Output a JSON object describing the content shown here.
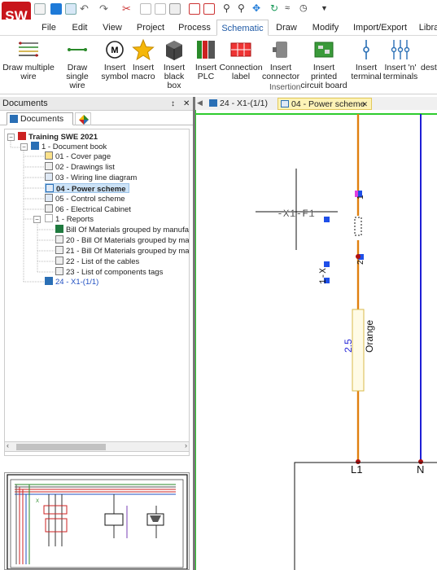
{
  "app": {
    "logo_text": "SW"
  },
  "menu": {
    "tabs": [
      "File",
      "Edit",
      "View",
      "Project",
      "Process",
      "Schematic",
      "Draw",
      "Modify",
      "Import/Export",
      "Libra"
    ],
    "active": "Schematic"
  },
  "ribbon": {
    "buttons": [
      {
        "line1": "Draw multiple",
        "line2": "wire",
        "icon": "multi-wire-icon"
      },
      {
        "line1": "Draw single",
        "line2": "wire",
        "icon": "single-wire-icon"
      },
      {
        "line1": "Insert",
        "line2": "symbol",
        "icon": "motor-symbol-icon"
      },
      {
        "line1": "Insert",
        "line2": "macro",
        "icon": "star-macro-icon"
      },
      {
        "line1": "Insert",
        "line2": "black box",
        "icon": "black-box-icon"
      },
      {
        "line1": "Insert",
        "line2": "PLC",
        "icon": "plc-icon"
      },
      {
        "line1": "Connection",
        "line2": "label",
        "icon": "connection-label-icon"
      },
      {
        "line1": "Insert",
        "line2": "connector",
        "icon": "connector-icon"
      },
      {
        "line1": "Insert printed",
        "line2": "circuit board",
        "icon": "pcb-icon"
      },
      {
        "line1": "Insert",
        "line2": "terminal",
        "icon": "terminal-icon"
      },
      {
        "line1": "Insert 'n'",
        "line2": "terminals",
        "icon": "n-terminals-icon"
      },
      {
        "line1": "desti",
        "line2": "",
        "icon": ""
      }
    ],
    "group_label": "Insertion"
  },
  "documents_panel": {
    "title": "Documents",
    "pin": "↕",
    "close": "✕",
    "tabs": [
      "Documents",
      ""
    ],
    "tree": [
      {
        "label": "Training SWE 2021",
        "level": 0,
        "bold": true,
        "icon": "project-icon"
      },
      {
        "label": "1 - Document book",
        "level": 1,
        "icon": "book-icon"
      },
      {
        "label": "01 - Cover page",
        "level": 2,
        "icon": "cover-page-icon"
      },
      {
        "label": "02 - Drawings list",
        "level": 2,
        "icon": "drawings-list-icon"
      },
      {
        "label": "03 - Wiring line diagram",
        "level": 2,
        "icon": "wiring-diagram-icon"
      },
      {
        "label": "04 - Power scheme",
        "level": 2,
        "bold": true,
        "selected": true,
        "icon": "power-scheme-icon"
      },
      {
        "label": "05 - Control scheme",
        "level": 2,
        "icon": "control-scheme-icon"
      },
      {
        "label": "06 - Electrical Cabinet",
        "level": 2,
        "icon": "electrical-cabinet-icon"
      },
      {
        "label": "1 - Reports",
        "level": 2,
        "icon": "reports-folder-icon"
      },
      {
        "label": "Bill Of Materials grouped by manufactu",
        "level": 3,
        "icon": "excel-icon"
      },
      {
        "label": "20 - Bill Of Materials grouped by manuf",
        "level": 3,
        "icon": "report-icon"
      },
      {
        "label": "21 - Bill Of Materials grouped by manuf",
        "level": 3,
        "icon": "report-icon"
      },
      {
        "label": "22 - List of the cables",
        "level": 3,
        "icon": "report-icon"
      },
      {
        "label": "23 - List of components tags",
        "level": 3,
        "icon": "report-icon"
      },
      {
        "label": "24 - X1-(1/1)",
        "level": 2,
        "blue": true,
        "icon": "terminal-strip-icon"
      }
    ]
  },
  "doc_tabs": [
    {
      "label": "24 - X1-(1/1)",
      "active": false
    },
    {
      "label": "04 - Power scheme",
      "active": true,
      "close": "✕"
    }
  ],
  "canvas": {
    "component_tag": "-X1-F1",
    "pin_top": "1",
    "pin_bottom": "2",
    "wire_color_label": "Orange",
    "wire_section_label": "2.5",
    "phase_label": "L1",
    "neutral_label": "N",
    "side_tag": "1-X"
  }
}
